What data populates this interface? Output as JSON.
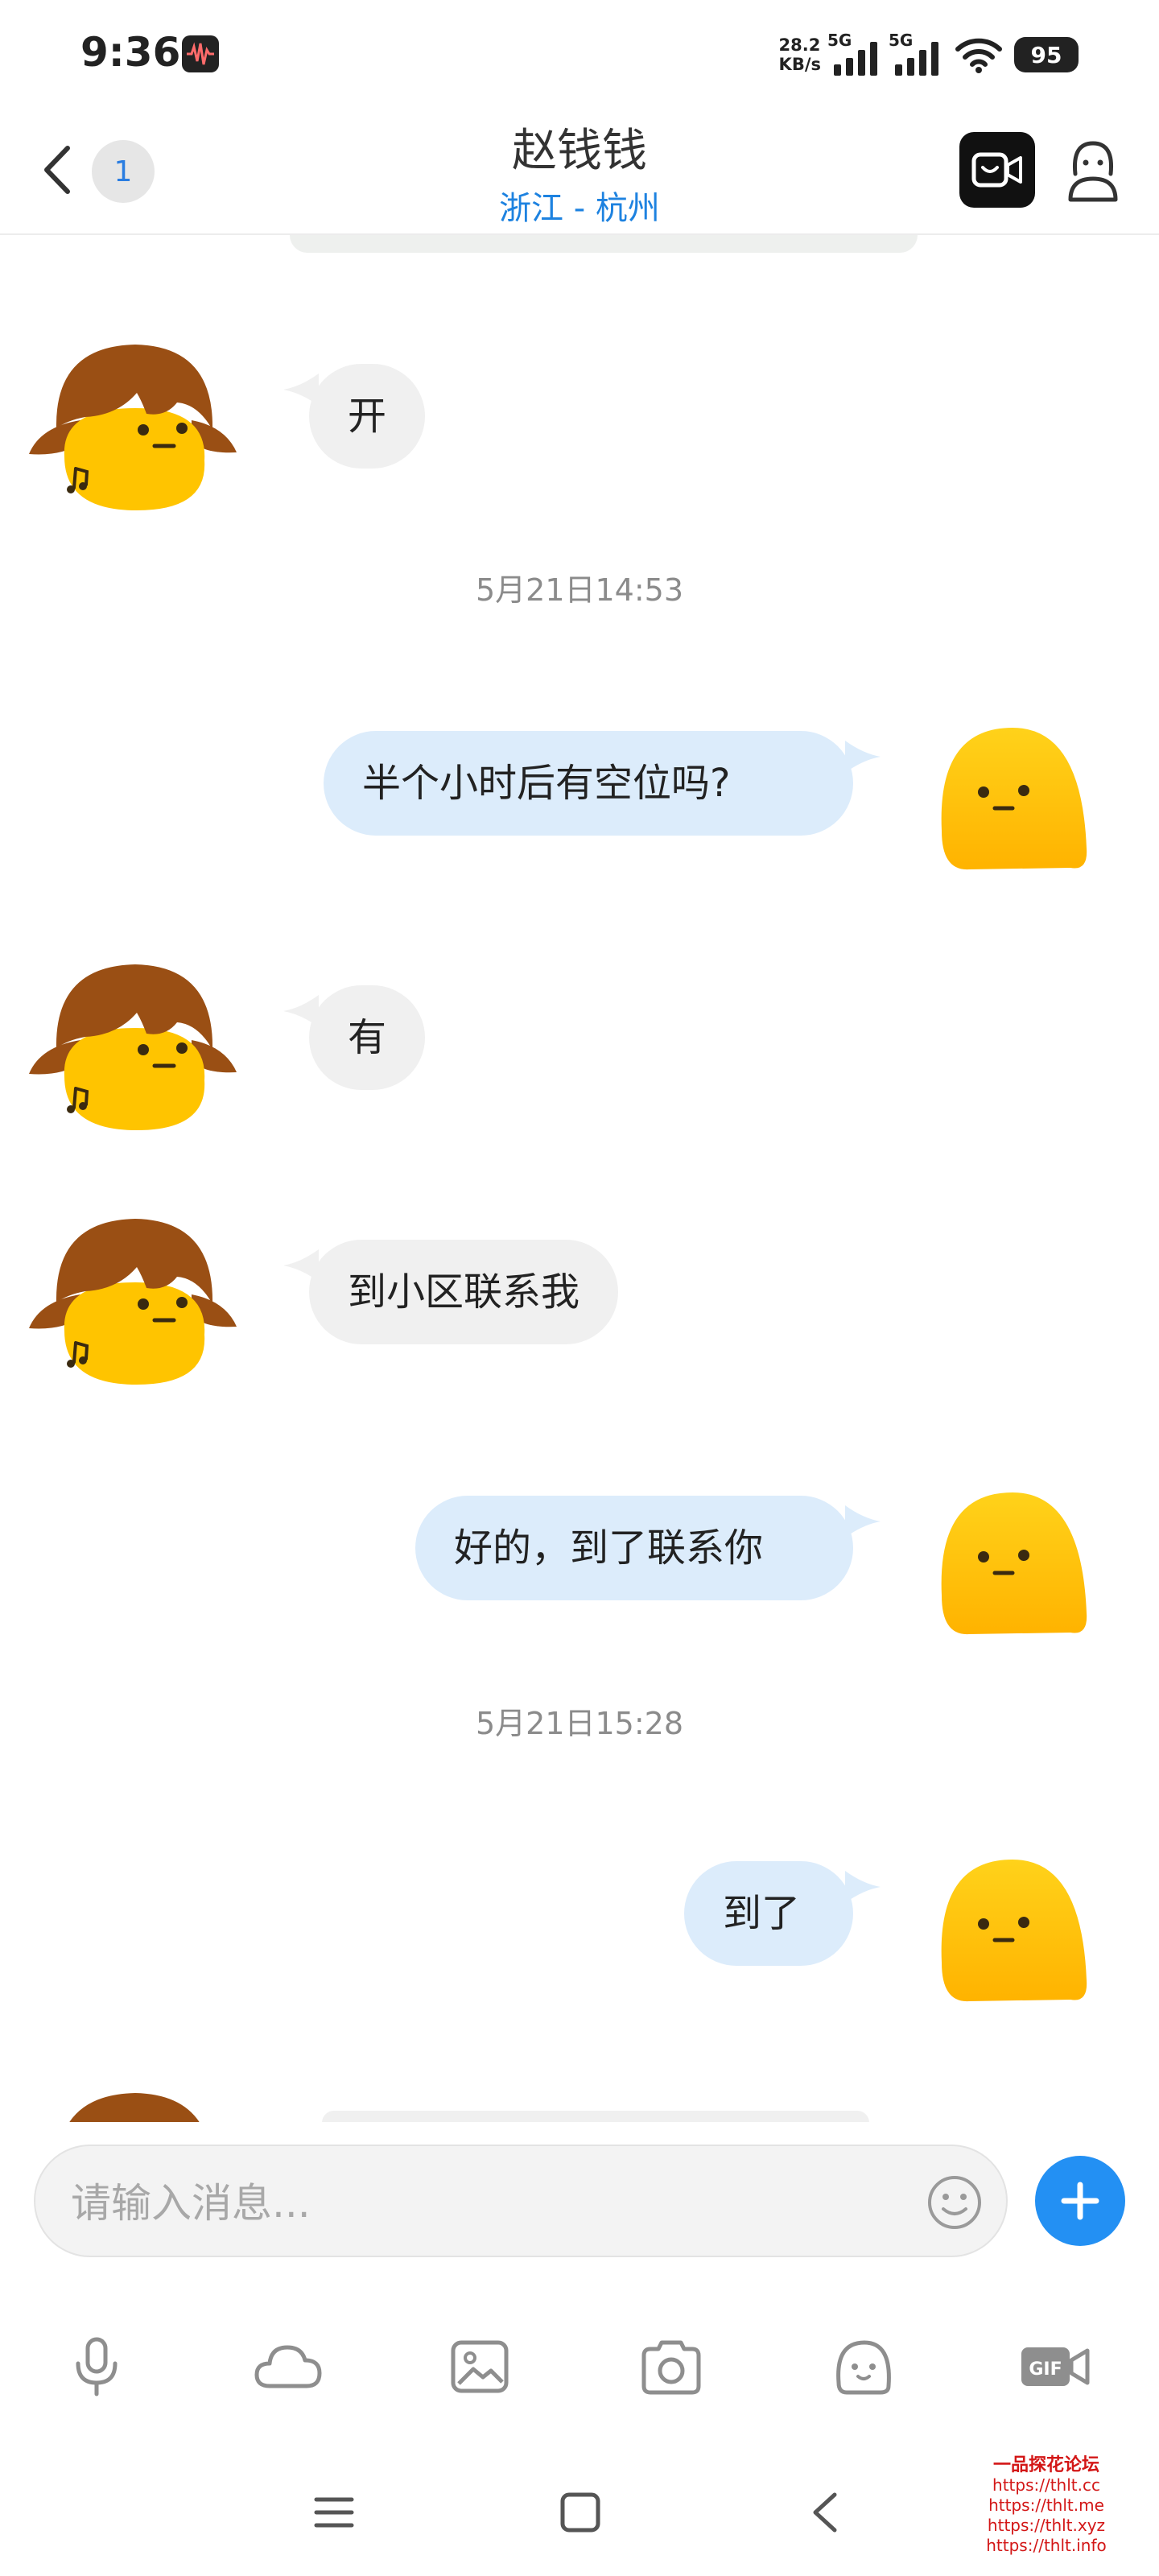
{
  "status_bar": {
    "time": "9:36",
    "net_speed_value": "28.2",
    "net_speed_unit": "KB/s",
    "signal1_label": "5G",
    "signal2_label": "5G",
    "battery": "95"
  },
  "header": {
    "unread_count": "1",
    "title": "赵钱钱",
    "subtitle": "浙江 - 杭州"
  },
  "messages": [
    {
      "direction": "in",
      "text": "开"
    },
    {
      "type": "timestamp",
      "text": "5月21日14:53"
    },
    {
      "direction": "out",
      "text": "半个小时后有空位吗?"
    },
    {
      "direction": "in",
      "text": "有"
    },
    {
      "direction": "in",
      "text": "到小区联系我"
    },
    {
      "direction": "out",
      "text": "好的，到了联系你"
    },
    {
      "type": "timestamp",
      "text": "5月21日15:28"
    },
    {
      "direction": "out",
      "text": "到了"
    }
  ],
  "input": {
    "placeholder": "请输入消息..."
  },
  "toolbar": {
    "items": [
      "mic-icon",
      "cloud-icon",
      "image-icon",
      "camera-icon",
      "sticker-icon",
      "gif-icon"
    ]
  },
  "watermark": {
    "title": "一品探花论坛",
    "lines": [
      "https://thlt.cc",
      "https://thlt.me",
      "https://thlt.xyz",
      "https://thlt.info"
    ]
  },
  "colors": {
    "accent_blue": "#2390f3",
    "location_blue": "#1d82e0",
    "incoming_bubble": "#f0f0f0",
    "outgoing_bubble": "#dcecfb",
    "avatar_yellow": "#ffc400",
    "hair_brown": "#9a4f14",
    "watermark_red": "#d31717"
  }
}
